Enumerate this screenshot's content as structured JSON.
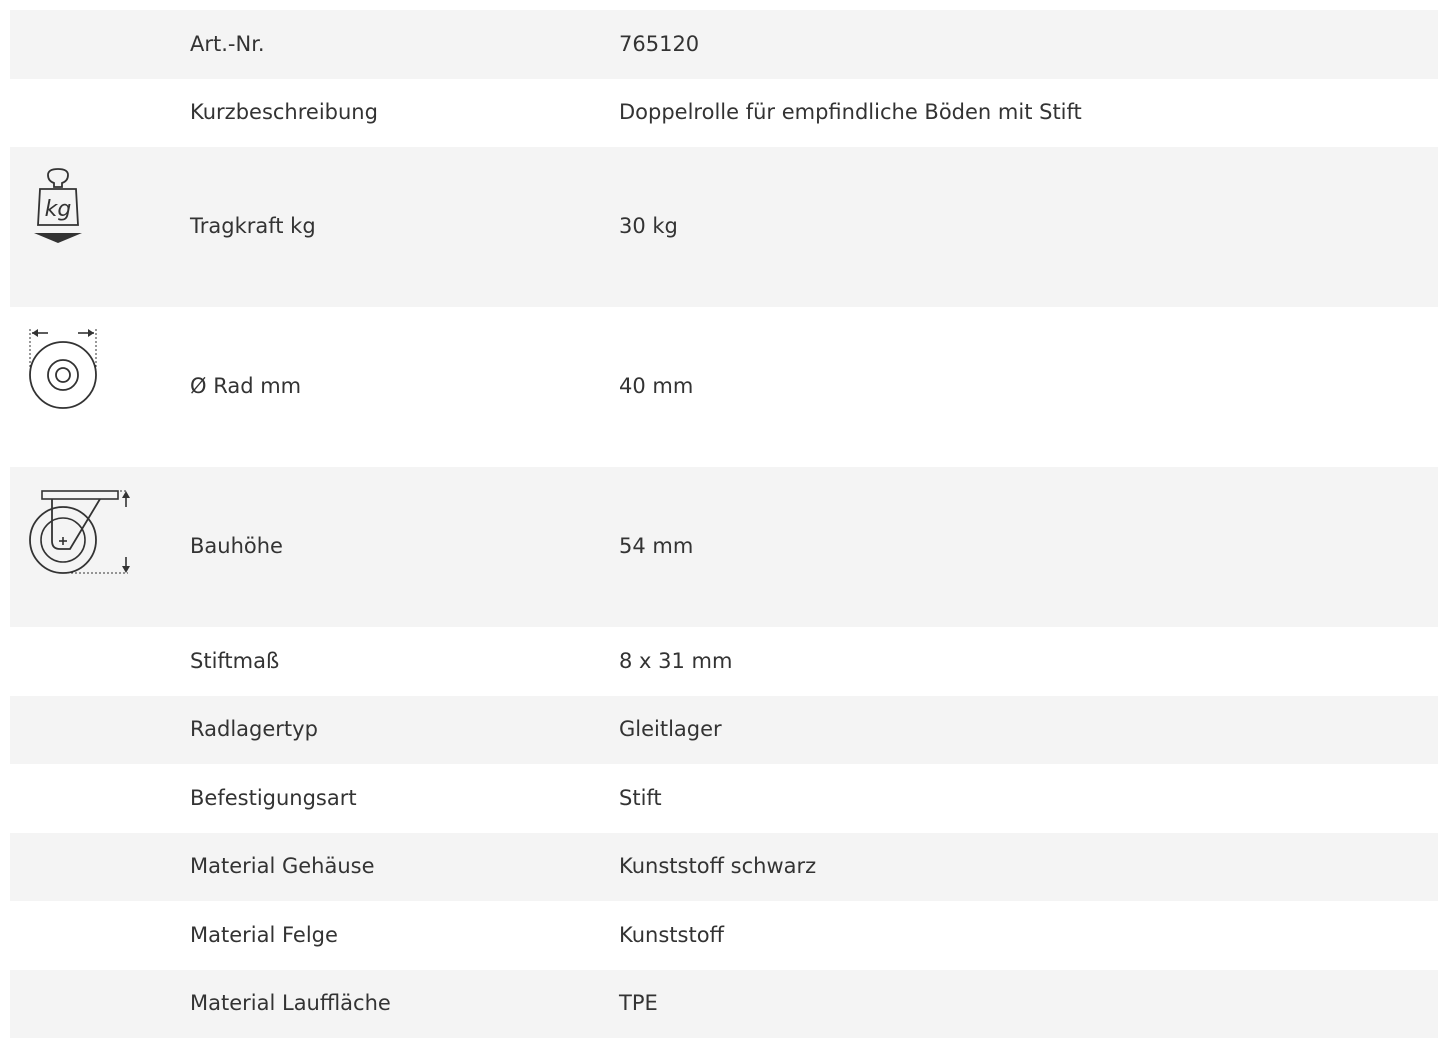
{
  "specs": [
    {
      "label": "Art.-Nr.",
      "value": "765120",
      "icon": null
    },
    {
      "label": "Kurzbeschreibung",
      "value": "Doppelrolle für empfindliche Böden mit Stift",
      "icon": null
    },
    {
      "label": "Tragkraft kg",
      "value": "30 kg",
      "icon": "weight-kg-icon",
      "icon_text": "kg"
    },
    {
      "label": "Ø Rad mm",
      "value": "40 mm",
      "icon": "wheel-diameter-icon"
    },
    {
      "label": "Bauhöhe",
      "value": "54 mm",
      "icon": "caster-height-icon"
    },
    {
      "label": "Stiftmaß",
      "value": "8 x 31 mm",
      "icon": null
    },
    {
      "label": "Radlagertyp",
      "value": "Gleitlager",
      "icon": null
    },
    {
      "label": "Befestigungsart",
      "value": "Stift",
      "icon": null
    },
    {
      "label": "Material Gehäuse",
      "value": "Kunststoff schwarz",
      "icon": null
    },
    {
      "label": "Material Felge",
      "value": "Kunststoff",
      "icon": null
    },
    {
      "label": "Material Lauffläche",
      "value": "TPE",
      "icon": null
    }
  ],
  "colors": {
    "row_shaded": "#f4f4f4",
    "row_white": "#ffffff",
    "text": "#333333",
    "icon": "#333333"
  }
}
